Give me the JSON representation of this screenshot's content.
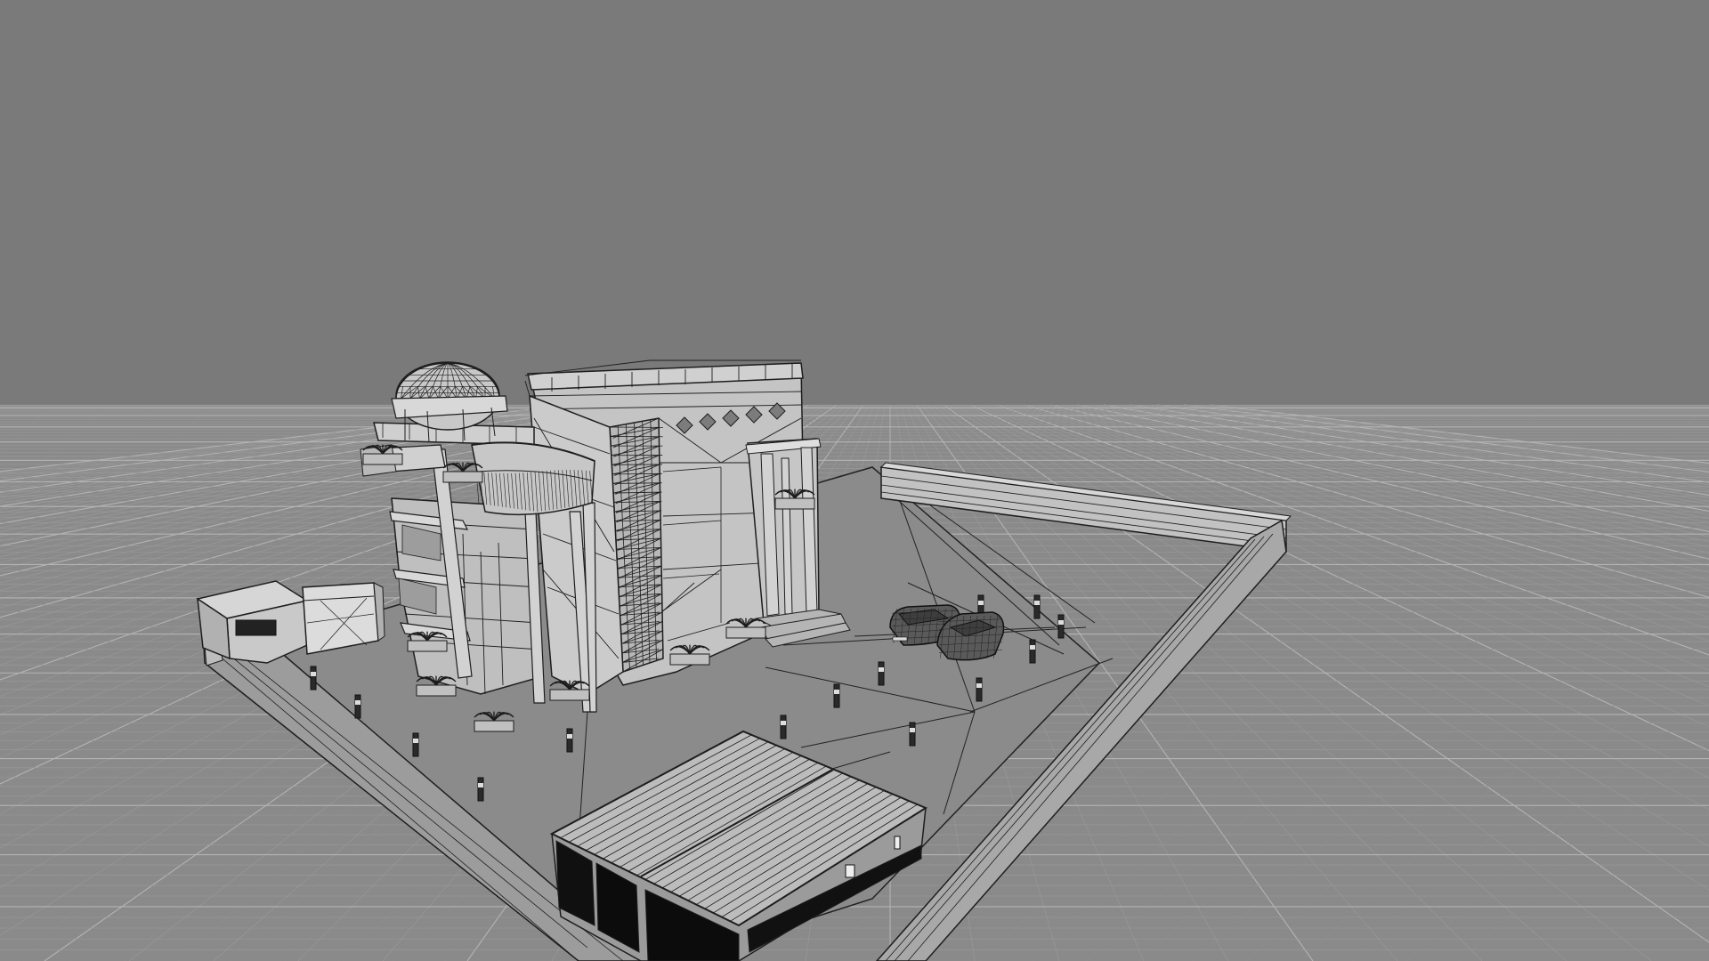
{
  "viewport": {
    "mode": "wireframe-on-shaded",
    "background_color": "#7a7a7a",
    "grid_color": "#9a9a9a",
    "grid_major_color": "#b4b4b4",
    "floor_color": "#8a8a8a",
    "wire_color": "#1e1e1e",
    "surface_light": "#c4c4c4",
    "surface_mid": "#a6a6a6",
    "surface_dark": "#6a6a6a"
  },
  "scene": {
    "objects": [
      "building-villa-icon",
      "dome-icon",
      "compound-wall-icon",
      "gatehouse-icon",
      "garage-roof-icon",
      "car-icon",
      "car-icon",
      "bollard-light-icon",
      "planter-icon"
    ]
  }
}
